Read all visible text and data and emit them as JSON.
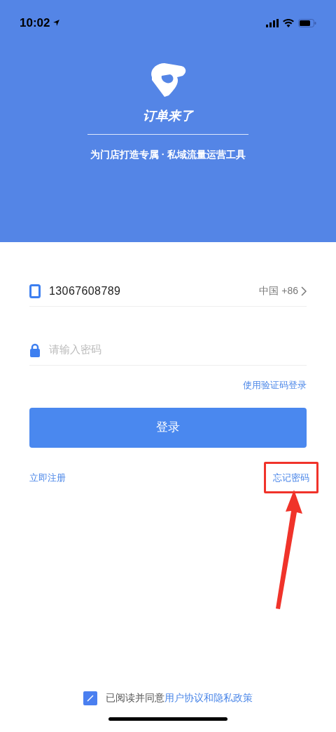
{
  "status_bar": {
    "time": "10:02"
  },
  "header": {
    "app_name": "订单来了",
    "slogan": "为门店打造专属 · 私域流量运营工具"
  },
  "form": {
    "phone": {
      "value": "13067608789",
      "region": "中国 +86"
    },
    "password": {
      "placeholder": "请输入密码"
    },
    "alt_login": "使用验证码登录",
    "submit": "登录",
    "register": "立即注册",
    "forgot": {
      "label": "忘记密码",
      "highlighted": true
    }
  },
  "agreement": {
    "checked": true,
    "text": "已阅读并同意",
    "link": "用户协议和隐私政策"
  }
}
